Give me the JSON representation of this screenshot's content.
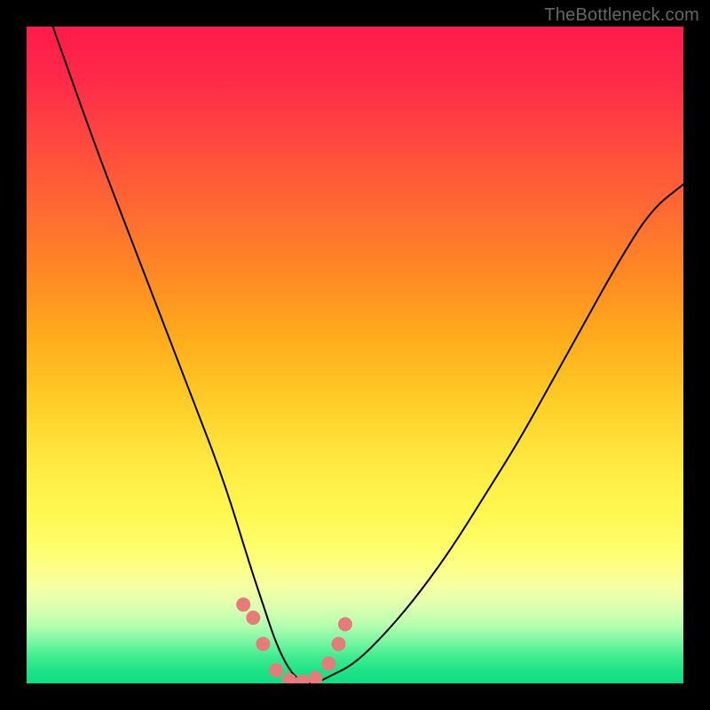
{
  "watermark_text": "TheBottleneck.com",
  "chart_data": {
    "type": "line",
    "title": "",
    "xlabel": "",
    "ylabel": "",
    "xlim": [
      0,
      100
    ],
    "ylim": [
      0,
      100
    ],
    "grid": false,
    "legend": false,
    "series": [
      {
        "name": "curve",
        "color": "#000000",
        "x": [
          4,
          10,
          15,
          20,
          25,
          30,
          34,
          36,
          38,
          40,
          42,
          44,
          46,
          50,
          55,
          60,
          65,
          70,
          75,
          80,
          85,
          90,
          95,
          100
        ],
        "y": [
          100,
          83,
          70,
          57,
          44,
          31,
          18,
          12,
          6,
          2,
          0,
          0,
          1,
          3,
          8,
          14,
          21,
          29,
          37,
          46,
          55,
          64,
          72,
          76
        ]
      },
      {
        "name": "bottom-dots",
        "color": "#e77a7a",
        "type": "scatter",
        "x": [
          33,
          34.5,
          36,
          38,
          40,
          42,
          44,
          46,
          47.5,
          48.5
        ],
        "y": [
          12,
          10,
          6,
          2,
          0.5,
          0.3,
          0.8,
          3,
          6,
          9
        ]
      }
    ],
    "background_gradient": {
      "direction": "vertical",
      "stops": [
        {
          "pos": 0,
          "color": "#ff1a4a"
        },
        {
          "pos": 28,
          "color": "#ff6a32"
        },
        {
          "pos": 58,
          "color": "#ffd028"
        },
        {
          "pos": 80,
          "color": "#ffff70"
        },
        {
          "pos": 94,
          "color": "#70f5a0"
        },
        {
          "pos": 100,
          "color": "#10dd82"
        }
      ]
    }
  }
}
